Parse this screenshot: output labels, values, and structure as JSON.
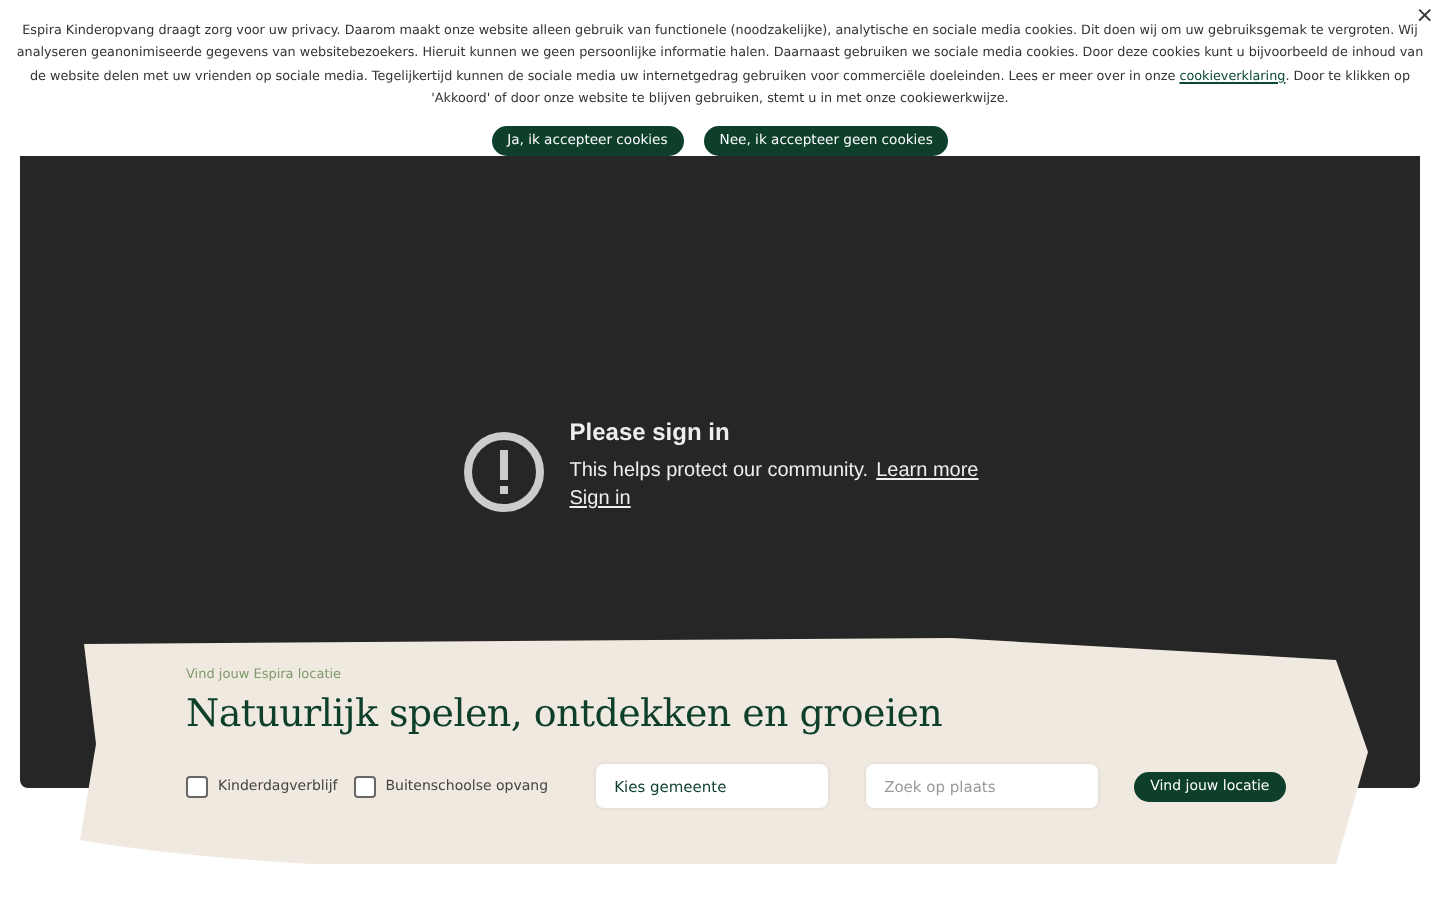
{
  "cookie_banner": {
    "close": "×",
    "text_before": "Espira Kinderopvang draagt zorg voor uw privacy. Daarom maakt onze website alleen gebruik van functionele (noodzakelijke), analytische en sociale media cookies. Dit doen wij om uw gebruiksgemak te vergroten. Wij analyseren geanonimiseerde gegevens van websitebezoekers. Hieruit kunnen we geen persoonlijke informatie halen. Daarnaast gebruiken we sociale media cookies. Door deze cookies kunt u bijvoorbeeld de inhoud van de website delen met uw vrienden op sociale media. Tegelijkertijd kunnen de sociale media uw internetgedrag gebruiken voor commerciële doeleinden.  Lees er meer over in onze",
    "link": "cookieverklaring",
    "text_after": ". Door te klikken op 'Akkoord' of door onze website te blijven gebruiken, stemt u in met onze cookiewerkwijze.",
    "buttons": [
      "Ja, ik accepteer cookies",
      "Nee, ik accepteer geen cookies"
    ]
  },
  "video": {
    "title": "Please sign in",
    "message": "This helps protect our community.",
    "learn_more": "Learn more",
    "sign_in": "Sign in"
  },
  "search_panel": {
    "eyebrow": "Vind jouw Espira locatie",
    "heading": "Natuurlijk spelen, ontdekken en groeien",
    "checkboxes": [
      {
        "label": "Kinderdagverblijf",
        "checked": false
      },
      {
        "label": "Buitenschoolse opvang",
        "checked": false
      }
    ],
    "municipality": {
      "value": "Kies gemeente"
    },
    "place": {
      "placeholder": "Zoek op plaats"
    },
    "button": "Vind jouw locatie"
  }
}
